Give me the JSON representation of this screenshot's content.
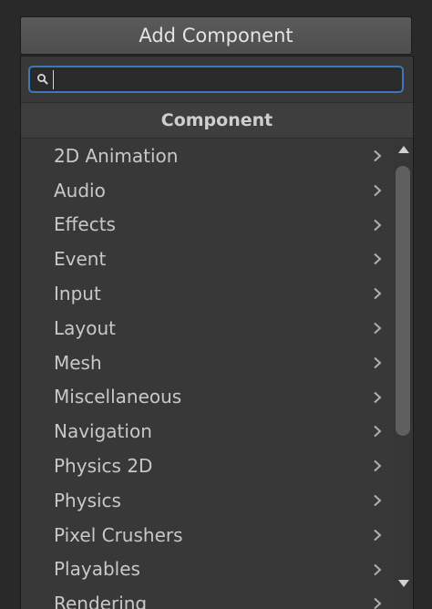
{
  "add_component_label": "Add Component",
  "search": {
    "value": "",
    "placeholder": ""
  },
  "header_title": "Component",
  "items": [
    {
      "label": "2D Animation"
    },
    {
      "label": "Audio"
    },
    {
      "label": "Effects"
    },
    {
      "label": "Event"
    },
    {
      "label": "Input"
    },
    {
      "label": "Layout"
    },
    {
      "label": "Mesh"
    },
    {
      "label": "Miscellaneous"
    },
    {
      "label": "Navigation"
    },
    {
      "label": "Physics 2D"
    },
    {
      "label": "Physics"
    },
    {
      "label": "Pixel Crushers"
    },
    {
      "label": "Playables"
    },
    {
      "label": "Rendering"
    }
  ],
  "icons": {
    "search": "search-icon",
    "submenu": "chevron-right-icon",
    "scroll_up": "arrow-up-icon",
    "scroll_down": "arrow-down-icon"
  },
  "colors": {
    "focus_border": "#3f77b8",
    "popup_bg": "#383838"
  }
}
